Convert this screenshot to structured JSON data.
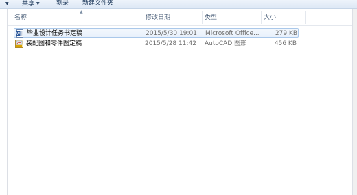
{
  "toolbar": {
    "share_label": "共享",
    "burn_label": "刻录",
    "new_folder_label": "新建文件夹"
  },
  "columns": {
    "name": "名称",
    "date_modified": "修改日期",
    "type": "类型",
    "size": "大小"
  },
  "files": [
    {
      "name": "毕业设计任务书定稿",
      "date_modified": "2015/5/30 19:01",
      "type": "Microsoft Office...",
      "size": "279 KB",
      "icon": "word-document-icon",
      "selected": true
    },
    {
      "name": "装配图和零件图定稿",
      "date_modified": "2015/5/28 11:42",
      "type": "AutoCAD 图形",
      "size": "456 KB",
      "icon": "autocad-drawing-icon",
      "selected": false
    }
  ],
  "colors": {
    "toolbar_bg": "#dde8f5",
    "selection_border": "#aac8ea",
    "text_dark": "#1e395b"
  }
}
